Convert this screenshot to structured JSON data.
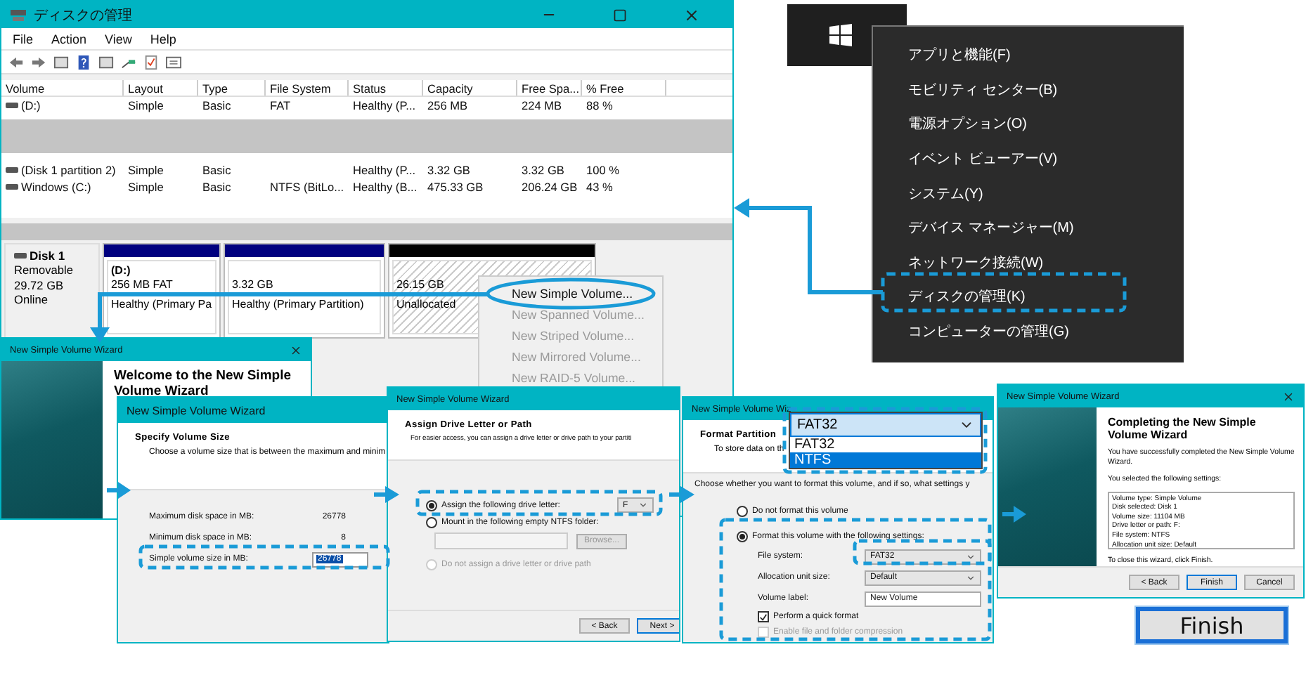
{
  "disk_management": {
    "title": "ディスクの管理",
    "menu": [
      "File",
      "Action",
      "View",
      "Help"
    ],
    "columns": [
      "Volume",
      "Layout",
      "Type",
      "File System",
      "Status",
      "Capacity",
      "Free Spa...",
      "% Free"
    ],
    "rows": [
      {
        "kind": "volume",
        "cells": [
          "(D:)",
          "Simple",
          "Basic",
          "FAT",
          "Healthy (P...",
          "256 MB",
          "224 MB",
          "88 %"
        ]
      },
      {
        "kind": "gap"
      },
      {
        "kind": "volume",
        "cells": [
          "(Disk 1 partition 2)",
          "Simple",
          "Basic",
          null,
          "Healthy (P...",
          "3.32 GB",
          "3.32 GB",
          "100 %"
        ]
      },
      {
        "kind": "volume",
        "cells": [
          "Windows (C:)",
          "Simple",
          "Basic",
          "NTFS (BitLo...",
          "Healthy (B...",
          "475.33 GB",
          "206.24 GB",
          "43 %"
        ]
      }
    ],
    "disk": {
      "name": "Disk 1",
      "type": "Removable",
      "size": "29.72 GB",
      "status": "Online",
      "partitions": [
        {
          "kind": "primary",
          "label": "(D:)",
          "size": "256 MB FAT",
          "status": "Healthy (Primary Pa"
        },
        {
          "kind": "primary",
          "size": "3.32 GB",
          "status": "Healthy (Primary Partition)"
        },
        {
          "kind": "unallocated",
          "size": "26.15 GB",
          "status": "Unallocated"
        }
      ]
    }
  },
  "context_menu": {
    "items": [
      {
        "label": "New Simple Volume...",
        "disabled": false
      },
      {
        "label": "New Spanned Volume...",
        "disabled": true
      },
      {
        "label": "New Striped Volume...",
        "disabled": true
      },
      {
        "label": "New Mirrored Volume...",
        "disabled": true
      },
      {
        "label": "New RAID-5 Volume...",
        "disabled": true
      }
    ]
  },
  "start_menu": {
    "items": [
      "アプリと機能(F)",
      "モビリティ センター(B)",
      "電源オプション(O)",
      "イベント ビューアー(V)",
      "システム(Y)",
      "デバイス マネージャー(M)",
      "ネットワーク接続(W)",
      "ディスクの管理(K)",
      "コンピューターの管理(G)"
    ]
  },
  "welcome_wizard": {
    "title": "New Simple Volume Wizard",
    "heading": "Welcome to the New Simple Volume Wizard"
  },
  "size_wizard": {
    "title": "New Simple Volume Wizard",
    "heading": "Specify Volume Size",
    "subtitle": "Choose a volume size that is between the maximum and minim",
    "fields": [
      {
        "kind": "readout",
        "label": "Maximum disk space in MB:",
        "value": "26778"
      },
      {
        "kind": "readout",
        "label": "Minimum disk space in MB:",
        "value": "8"
      },
      {
        "kind": "spinner",
        "label": "Simple volume size in MB:",
        "value": "26778"
      }
    ]
  },
  "drive_letter_wizard": {
    "title": "New Simple Volume Wizard",
    "heading": "Assign Drive Letter or Path",
    "subtitle": "For easier access, you can assign a drive letter or drive path to your partiti",
    "options": [
      {
        "kind": "letter",
        "label": "Assign the following drive letter:",
        "selected": true,
        "disabled": false,
        "value": "F"
      },
      {
        "kind": "folder",
        "label": "Mount in the following empty NTFS folder:",
        "selected": false,
        "disabled": false,
        "button": "Browse..."
      },
      {
        "kind": "plain",
        "label": "Do not assign a drive letter or drive path",
        "selected": false,
        "disabled": true
      }
    ],
    "buttons": [
      "< Back",
      "Next >"
    ]
  },
  "format_wizard": {
    "title": "New Simple Volume Wiz",
    "heading": "Format Partition",
    "subtitle": "To store data on th",
    "prompt": "Choose whether you want to format this volume, and if so, what settings y",
    "options": [
      {
        "label": "Do not format this volume",
        "selected": false
      },
      {
        "label": "Format this volume with the following settings:",
        "selected": true
      }
    ],
    "settings": [
      {
        "kind": "select",
        "label": "File system:",
        "value": "FAT32"
      },
      {
        "kind": "select",
        "label": "Allocation unit size:",
        "value": "Default"
      },
      {
        "kind": "text",
        "label": "Volume label:",
        "value": "New Volume"
      }
    ],
    "checks": [
      {
        "label": "Perform a quick format",
        "checked": true,
        "disabled": false
      },
      {
        "label": "Enable file and folder compression",
        "checked": false,
        "disabled": true
      }
    ],
    "dropdown": {
      "value": "FAT32",
      "options": [
        {
          "label": "FAT32",
          "highlighted": false
        },
        {
          "label": "NTFS",
          "highlighted": true
        }
      ]
    }
  },
  "complete_wizard": {
    "title": "New Simple Volume Wizard",
    "heading": "Completing the New Simple Volume Wizard",
    "intro": "You have successfully completed the New Simple Volume Wizard.",
    "list_caption": "You selected the following settings:",
    "settings": [
      "Volume type: Simple Volume",
      "Disk selected: Disk 1",
      "Volume size: 11104 MB",
      "Drive letter or path: F:",
      "File system: NTFS",
      "Allocation unit size: Default"
    ],
    "closing": "To close this wizard, click Finish.",
    "buttons": [
      {
        "label": "< Back",
        "focused": false
      },
      {
        "label": "Finish",
        "focused": true
      },
      {
        "label": "Cancel",
        "focused": false
      }
    ]
  },
  "finish_callout": {
    "label": "Finish"
  }
}
